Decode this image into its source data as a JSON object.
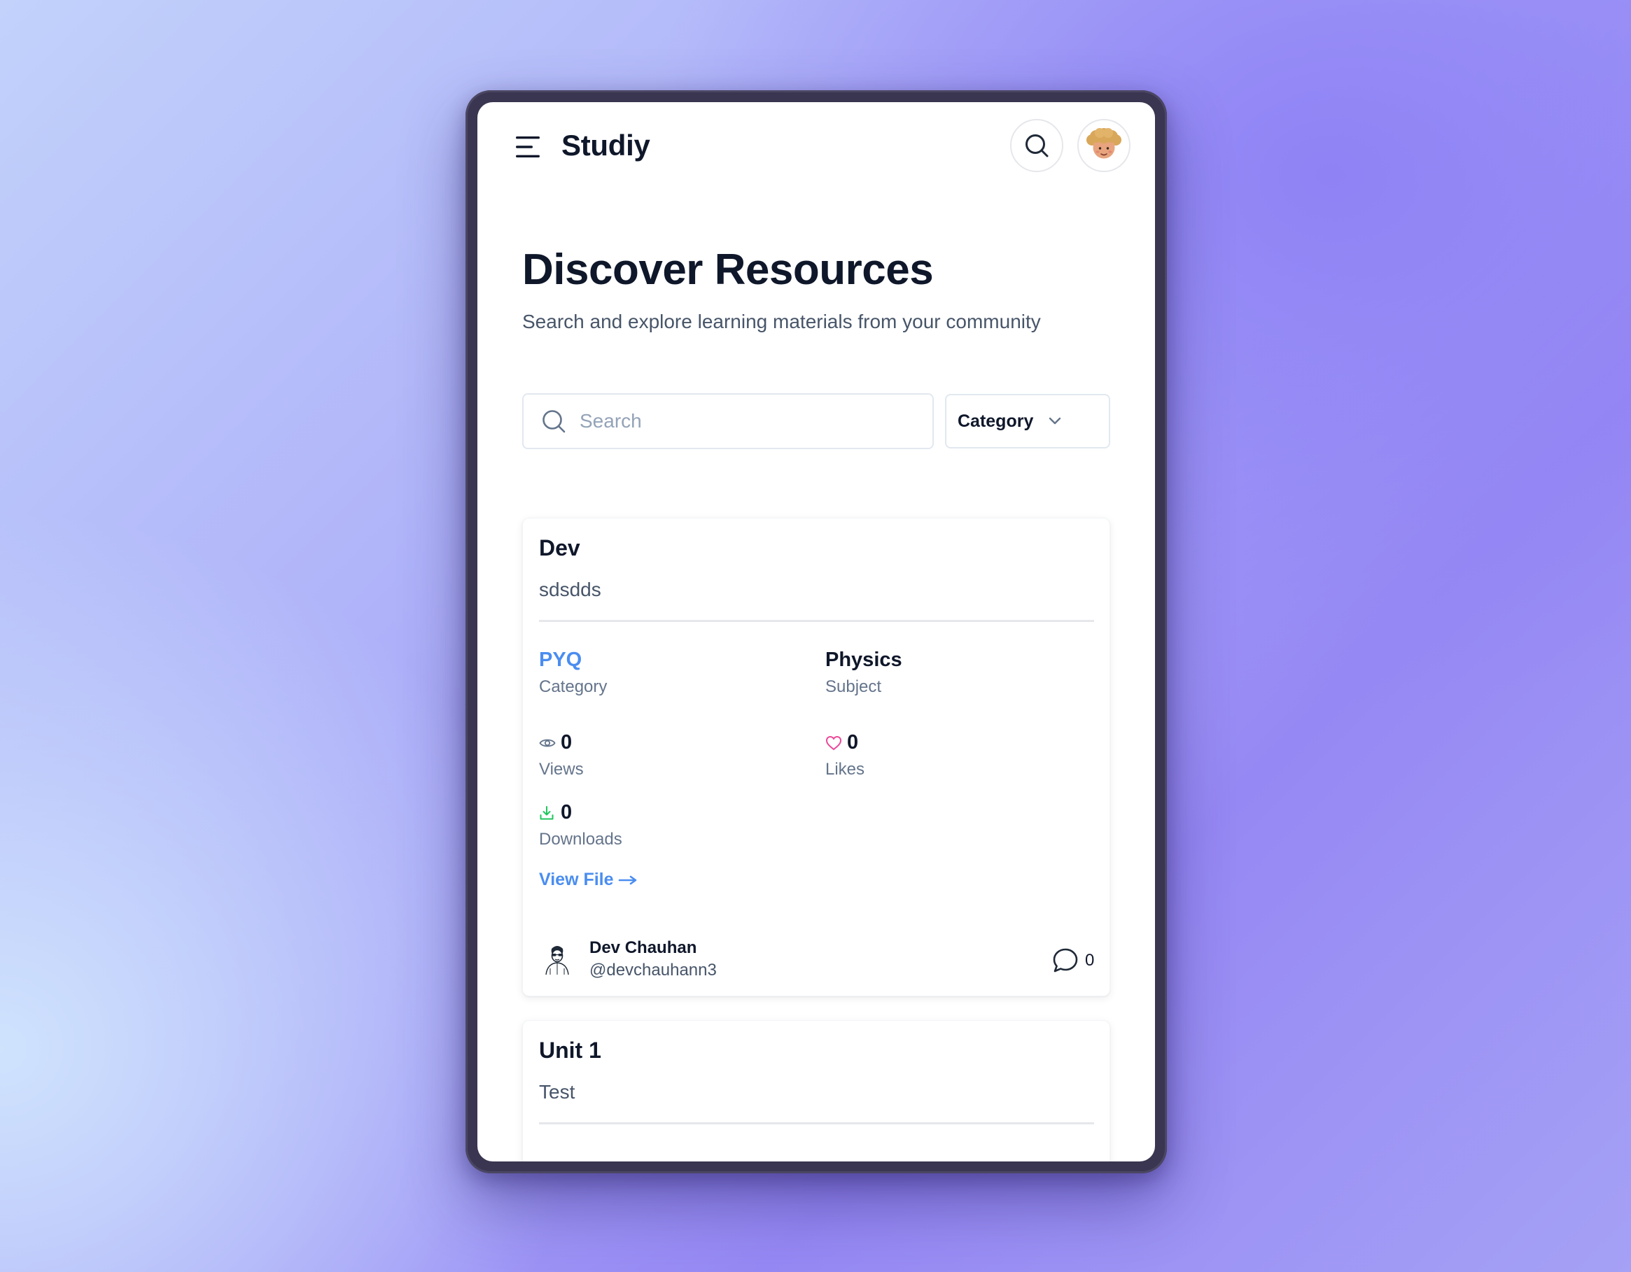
{
  "header": {
    "app_name": "Studiy",
    "icons": {
      "menu": "menu-icon",
      "search": "search-icon",
      "avatar": "user-avatar"
    }
  },
  "page": {
    "title": "Discover Resources",
    "subtitle": "Search and explore learning materials from your community"
  },
  "filters": {
    "search_placeholder": "Search",
    "search_value": "",
    "category_label": "Category"
  },
  "resources": [
    {
      "title": "Dev",
      "description": "sdsdds",
      "category_value": "PYQ",
      "category_caption": "Category",
      "subject_value": "Physics",
      "subject_caption": "Subject",
      "views": "0",
      "views_caption": "Views",
      "likes": "0",
      "likes_caption": "Likes",
      "downloads": "0",
      "downloads_caption": "Downloads",
      "view_file_label": "View File",
      "author_name": "Dev Chauhan",
      "author_handle": "@devchauhann3",
      "comments": "0"
    },
    {
      "title": "Unit 1",
      "description": "Test"
    }
  ],
  "colors": {
    "accent_link": "#4a8df0",
    "like_heart": "#ec4899",
    "download_arrow": "#22c55e",
    "text_primary": "#0f172a",
    "text_secondary": "#64748b"
  }
}
